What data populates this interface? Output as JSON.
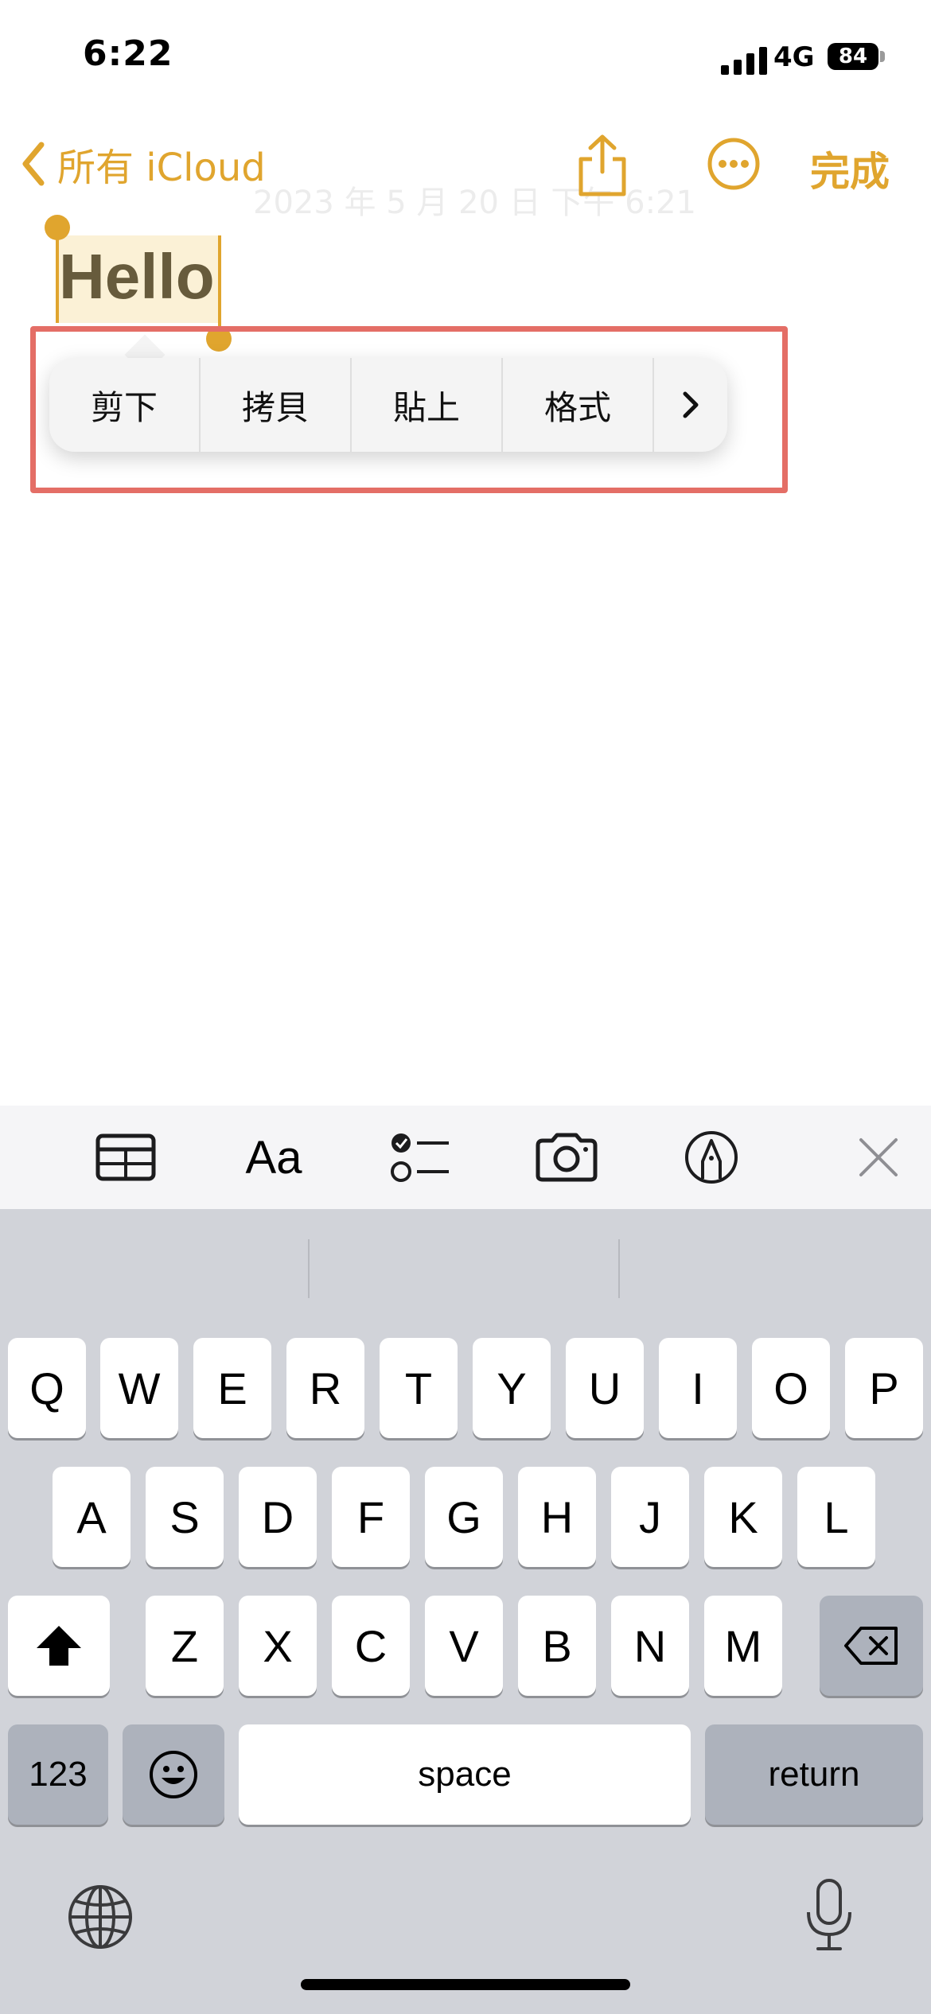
{
  "status_bar": {
    "time": "6:22",
    "network": "4G",
    "battery": "84"
  },
  "nav": {
    "back_label": "所有 iCloud",
    "done_label": "完成",
    "faded_date": "2023 年 5 月 20 日 下午 6:21"
  },
  "note": {
    "selected_text": "Hello"
  },
  "edit_menu": {
    "items": [
      "剪下",
      "拷貝",
      "貼上",
      "格式"
    ],
    "more_glyph": "›"
  },
  "toolbar": {
    "icons": [
      "table-icon",
      "text-format-icon",
      "checklist-icon",
      "camera-icon",
      "markup-pen-icon",
      "close-icon"
    ],
    "format_label": "Aa"
  },
  "keyboard": {
    "row1": [
      "Q",
      "W",
      "E",
      "R",
      "T",
      "Y",
      "U",
      "I",
      "O",
      "P"
    ],
    "row2": [
      "A",
      "S",
      "D",
      "F",
      "G",
      "H",
      "J",
      "K",
      "L"
    ],
    "row3": [
      "Z",
      "X",
      "C",
      "V",
      "B",
      "N",
      "M"
    ],
    "numbers_label": "123",
    "space_label": "space",
    "return_label": "return"
  },
  "colors": {
    "accent": "#e0a52e",
    "highlight": "#fbf1d6",
    "annotation": "#e46e66",
    "keyboard_bg": "#d1d3d9"
  }
}
